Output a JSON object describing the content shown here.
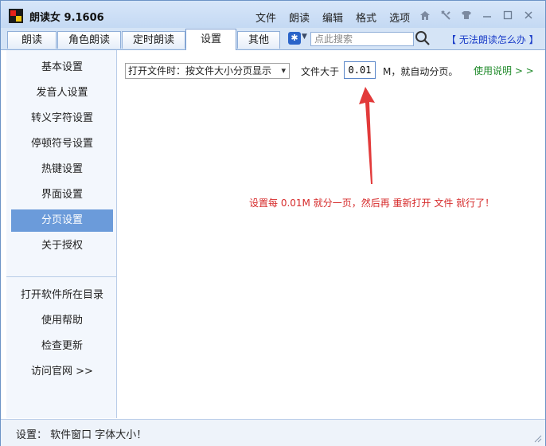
{
  "app": {
    "title": "朗读女  9.1606"
  },
  "menu": [
    "文件",
    "朗读",
    "编辑",
    "格式",
    "选项"
  ],
  "titlebar_icons": [
    "home-icon",
    "pin-icon",
    "skin-icon",
    "minimize-icon",
    "maximize-icon",
    "close-icon"
  ],
  "tabs": [
    {
      "label": "朗读"
    },
    {
      "label": "角色朗读"
    },
    {
      "label": "定时朗读"
    },
    {
      "label": "设置",
      "active": true
    },
    {
      "label": "其他"
    }
  ],
  "search": {
    "placeholder": "点此搜索"
  },
  "help_link": "【 无法朗读怎么办 】",
  "sidebar": {
    "items": [
      {
        "label": "基本设置"
      },
      {
        "label": "发音人设置"
      },
      {
        "label": "转义字符设置"
      },
      {
        "label": "停顿符号设置"
      },
      {
        "label": "热键设置"
      },
      {
        "label": "界面设置"
      },
      {
        "label": "分页设置",
        "active": true
      },
      {
        "label": "关于授权"
      }
    ],
    "bottom_items": [
      {
        "label": "打开软件所在目录"
      },
      {
        "label": "使用帮助"
      },
      {
        "label": "检查更新"
      },
      {
        "label": "访问官网 >>"
      }
    ]
  },
  "paging": {
    "open_mode": "打开文件时：按文件大小分页显示",
    "size_label": "文件大于",
    "size_value": "0.01",
    "size_suffix": "M，就自动分页。",
    "usage_link": "使用说明 > >"
  },
  "annotation": "设置每 0.01M 就分一页，然后再 重新打开 文件 就行了！",
  "status": {
    "text": "设置：  软件窗口 字体大小！"
  },
  "colors": {
    "accent": "#6b9bda",
    "annotation": "#d62b2b",
    "link_blue": "#1a3cc8",
    "link_green": "#1f8a2a"
  }
}
